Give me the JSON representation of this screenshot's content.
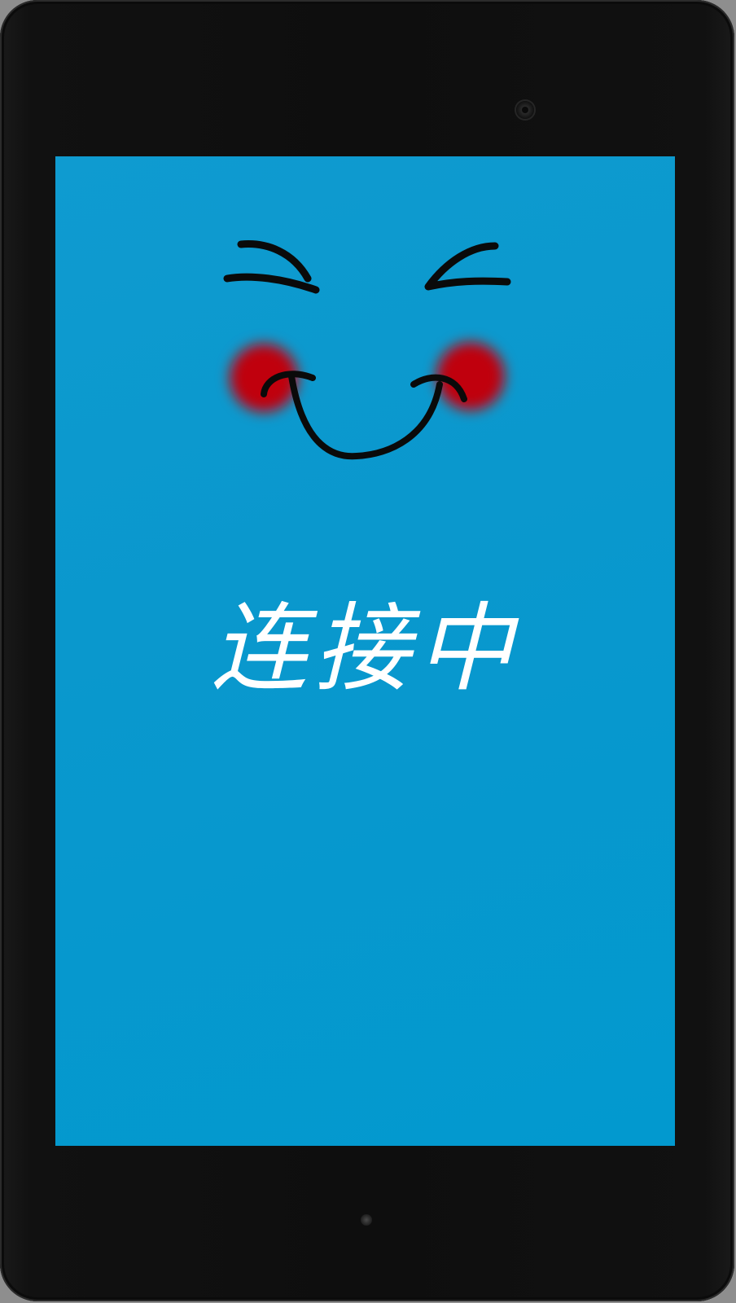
{
  "screen": {
    "status_text": "连接中",
    "background_color": "#0299cf"
  },
  "face": {
    "stroke_color": "#0a0a0a",
    "cheek_color": "#c0000a",
    "icon": "laughing-face"
  }
}
